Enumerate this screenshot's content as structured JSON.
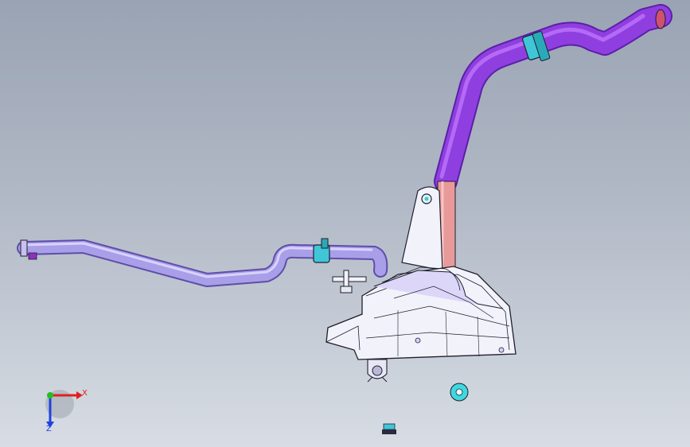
{
  "viewport": {
    "background_top": "#9aa3b3",
    "background_bottom": "#d8dde4"
  },
  "model": {
    "hose_color": "#8f3fe0",
    "hose_dark": "#5b1fa8",
    "lower_pipe_color": "#a99ee8",
    "lower_pipe_dark": "#5d4fa8",
    "riser_color": "#e89a9a",
    "clamp_color": "#3fc7d8",
    "housing_color": "#f2f2fa",
    "outline_color": "#1f1f2e"
  },
  "triad": {
    "x_label": "X",
    "z_label": "Z",
    "x_color": "#e02020",
    "y_color": "#20c020",
    "z_color": "#2040e0",
    "icons": [
      "triad-icon"
    ]
  }
}
